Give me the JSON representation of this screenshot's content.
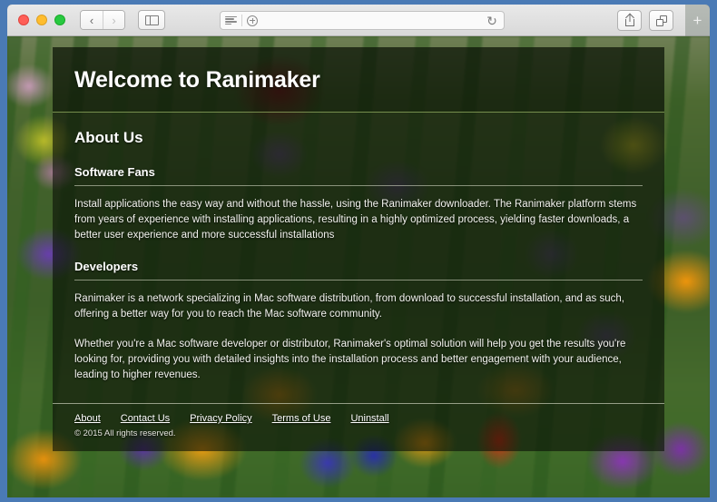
{
  "browser": {
    "traffic_lights": [
      "close",
      "minimize",
      "maximize"
    ],
    "back_label": "‹",
    "forward_label": "›",
    "sidebar_label": "sidebar",
    "url_value": "",
    "url_placeholder": "",
    "reload_label": "↻",
    "newtab_label": "+"
  },
  "page": {
    "title": "Welcome to Ranimaker",
    "about": {
      "heading": "About Us",
      "software_fans": {
        "heading": "Software Fans",
        "paragraph": "Install applications the easy way and without the hassle, using the Ranimaker downloader. The Ranimaker platform stems from years of experience with installing applications, resulting in a highly optimized process, yielding faster downloads, a better user experience and more successful installations"
      },
      "developers": {
        "heading": "Developers",
        "paragraph_1": "Ranimaker is a network specializing in Mac software distribution, from download to successful installation, and as such, offering a better way for you to reach the Mac software community.",
        "paragraph_2": "Whether you're a Mac software developer or distributor, Ranimaker's optimal solution will help you get the results you're looking for, providing you with detailed insights into the installation process and better engagement with your audience, leading to higher revenues."
      }
    },
    "footer": {
      "links": [
        {
          "label": "About"
        },
        {
          "label": "Contact Us"
        },
        {
          "label": "Privacy Policy"
        },
        {
          "label": "Terms of Use"
        },
        {
          "label": "Uninstall"
        }
      ],
      "copyright": "© 2015 All rights reserved."
    }
  },
  "colors": {
    "frame_blue": "#4a7ab5",
    "toolbar_grey": "#e4e4e4",
    "panel_overlay": "rgba(8,14,5,0.62)",
    "divider_green": "#a8c46e",
    "text_white": "#ffffff"
  }
}
